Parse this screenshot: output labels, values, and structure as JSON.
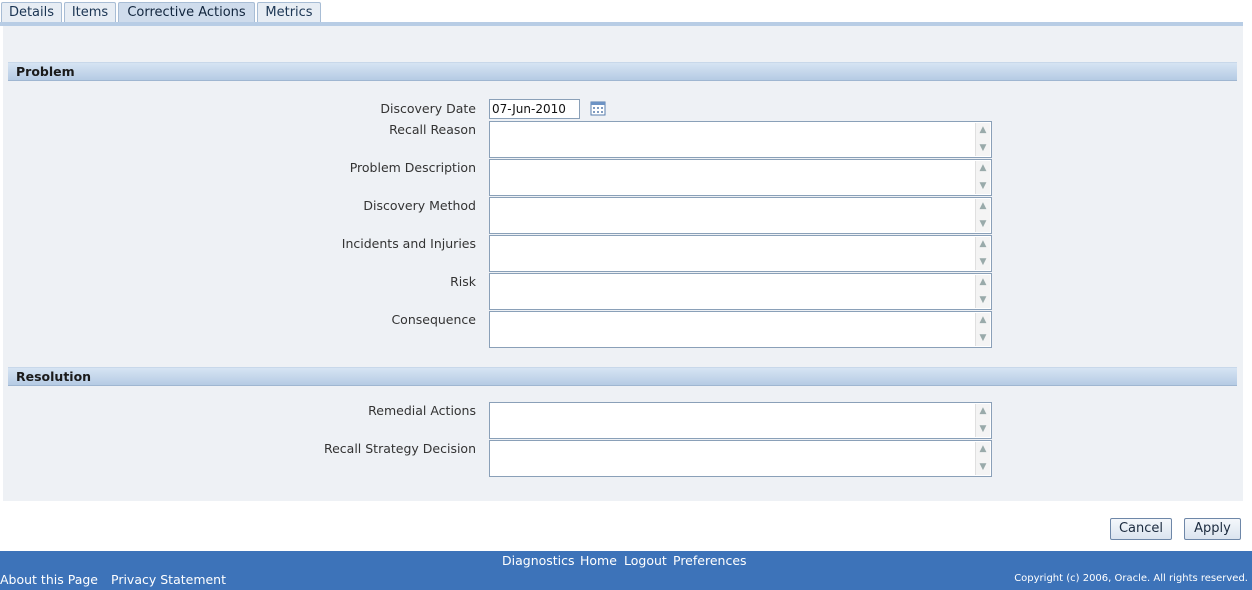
{
  "tabs": [
    {
      "label": "Details"
    },
    {
      "label": "Items"
    },
    {
      "label": "Corrective Actions"
    },
    {
      "label": "Metrics"
    }
  ],
  "active_tab": "Corrective Actions",
  "problem": {
    "header": "Problem",
    "discovery_date_label": "Discovery Date",
    "discovery_date_value": "07-Jun-2010",
    "fields": [
      {
        "label": "Recall Reason",
        "value": ""
      },
      {
        "label": "Problem Description",
        "value": ""
      },
      {
        "label": "Discovery Method",
        "value": ""
      },
      {
        "label": "Incidents and Injuries",
        "value": ""
      },
      {
        "label": "Risk",
        "value": ""
      },
      {
        "label": "Consequence",
        "value": ""
      }
    ]
  },
  "resolution": {
    "header": "Resolution",
    "fields": [
      {
        "label": "Remedial Actions",
        "value": ""
      },
      {
        "label": "Recall Strategy Decision",
        "value": ""
      }
    ]
  },
  "buttons": {
    "cancel": "Cancel",
    "apply": "Apply"
  },
  "footer": {
    "links": [
      "Diagnostics",
      "Home",
      "Logout",
      "Preferences"
    ],
    "about": "About this Page",
    "privacy": "Privacy Statement",
    "copyright": "Copyright (c) 2006, Oracle. All rights reserved."
  },
  "colors": {
    "footer_bg": "#3d73b9",
    "panel_bg": "#eef1f5",
    "section_header": "#c4d6eb"
  },
  "icons": {
    "date_picker": "calendar-icon"
  }
}
